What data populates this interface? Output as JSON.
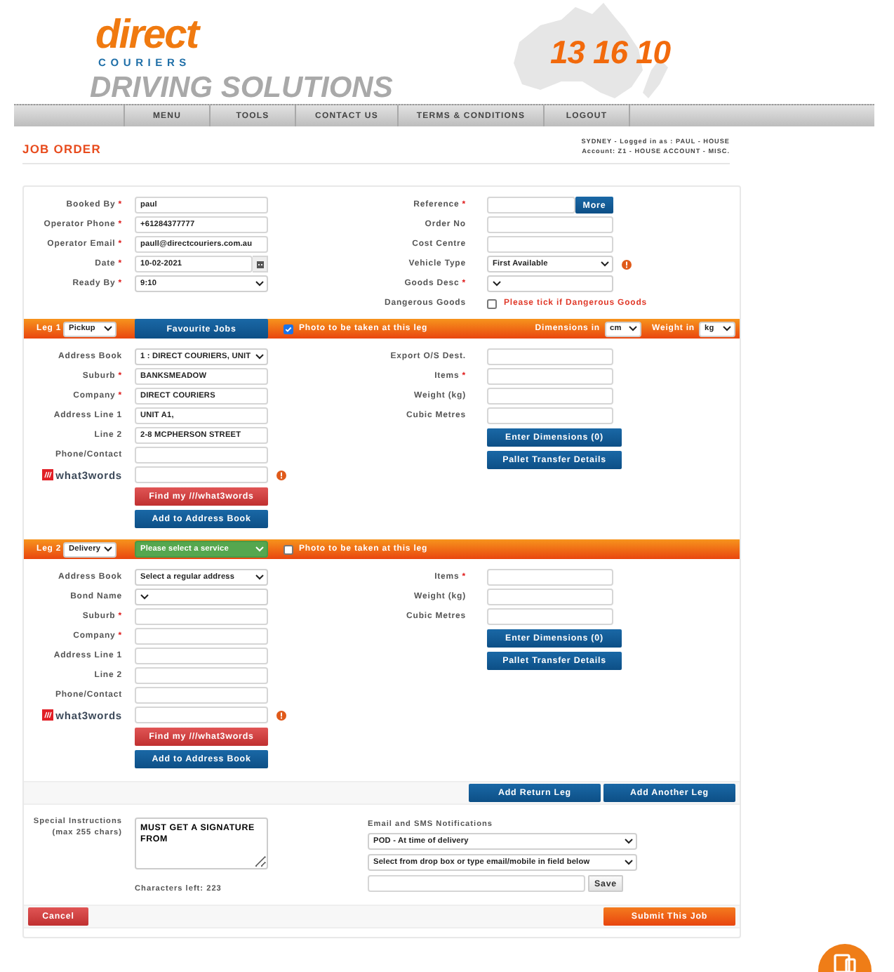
{
  "header": {
    "logo_top": "direct",
    "logo_bottom": "COURIERS",
    "tagline": "DRIVING SOLUTIONS",
    "phone": "13 16 10"
  },
  "nav": [
    "MENU",
    "TOOLS",
    "CONTACT US",
    "TERMS & CONDITIONS",
    "LOGOUT"
  ],
  "page_title": "JOB ORDER",
  "session": [
    "SYDNEY - Logged in as : PAUL - HOUSE",
    "Account: Z1 - HOUSE ACCOUNT - MISC."
  ],
  "booking": {
    "left": [
      {
        "kind": "text",
        "label": "Booked By",
        "required_mark": "*",
        "value": "paul"
      },
      {
        "kind": "text",
        "label": "Operator Phone",
        "required_mark": "*",
        "value": "+61284377777"
      },
      {
        "kind": "text",
        "label": "Operator Email",
        "required_mark": "*",
        "value": "paull@directcouriers.com.au"
      },
      {
        "kind": "date",
        "label": "Date",
        "required_mark": "*",
        "value": "10-02-2021"
      },
      {
        "kind": "select",
        "label": "Ready By",
        "required_mark": "*",
        "value": "9:10"
      }
    ],
    "right": [
      {
        "kind": "text",
        "label": "Reference",
        "required_mark": "*",
        "button": "More"
      },
      {
        "kind": "text",
        "label": "Order No"
      },
      {
        "kind": "text",
        "label": "Cost Centre"
      },
      {
        "kind": "select",
        "label": "Vehicle Type",
        "value": "First Available",
        "info": true
      },
      {
        "kind": "select",
        "label": "Goods Desc",
        "required_mark": "*"
      },
      {
        "kind": "check",
        "label": "Dangerous Goods",
        "checked": false,
        "note": "Please tick if Dangerous Goods"
      }
    ]
  },
  "legs": [
    {
      "label": "Leg 1",
      "type": "Pickup",
      "service": {
        "kind": "button",
        "text": "Favourite Jobs"
      },
      "photo": {
        "checked": true,
        "label": "Photo to be taken at this leg"
      },
      "units": [
        {
          "label": "Dimensions in",
          "value": "cm"
        },
        {
          "label": "Weight in",
          "value": "kg"
        }
      ],
      "left": [
        {
          "kind": "select",
          "label": "Address Book",
          "value": "1 : DIRECT COURIERS, UNIT"
        },
        {
          "kind": "text",
          "label": "Suburb",
          "required_mark": "*",
          "value": "BANKSMEADOW"
        },
        {
          "kind": "text",
          "label": "Company",
          "required_mark": "*",
          "value": "DIRECT COURIERS"
        },
        {
          "kind": "text",
          "label": "Address Line 1",
          "value": "UNIT A1,"
        },
        {
          "kind": "text",
          "label": "Line 2",
          "value": "2-8 MCPHERSON STREET"
        },
        {
          "kind": "text",
          "label": "Phone/Contact"
        },
        {
          "kind": "w3w",
          "label": "what3words",
          "info": true
        },
        {
          "kind": "redbutton",
          "label": "Find my ///what3words"
        },
        {
          "kind": "button",
          "label": "Add to Address Book"
        }
      ],
      "right": [
        {
          "kind": "text",
          "label": "Export O/S Dest."
        },
        {
          "kind": "text",
          "label": "Items",
          "required_mark": "*"
        },
        {
          "kind": "text",
          "label": "Weight (kg)"
        },
        {
          "kind": "text",
          "label": "Cubic Metres"
        },
        {
          "kind": "button",
          "label": "Enter Dimensions (0)"
        },
        {
          "kind": "button",
          "label": "Pallet Transfer Details"
        }
      ]
    },
    {
      "label": "Leg 2",
      "type": "Delivery",
      "service": {
        "kind": "select",
        "text": "Please select a service"
      },
      "photo": {
        "checked": false,
        "label": "Photo to be taken at this leg"
      },
      "left": [
        {
          "kind": "select",
          "label": "Address Book",
          "value": "Select a regular address"
        },
        {
          "kind": "select",
          "label": "Bond Name"
        },
        {
          "kind": "text",
          "label": "Suburb",
          "required_mark": "*"
        },
        {
          "kind": "text",
          "label": "Company",
          "required_mark": "*"
        },
        {
          "kind": "text",
          "label": "Address Line 1"
        },
        {
          "kind": "text",
          "label": "Line 2"
        },
        {
          "kind": "text",
          "label": "Phone/Contact"
        },
        {
          "kind": "w3w",
          "label": "what3words",
          "info": true
        },
        {
          "kind": "redbutton",
          "label": "Find my ///what3words"
        },
        {
          "kind": "button",
          "label": "Add to Address Book"
        }
      ],
      "right": [
        {
          "kind": "text",
          "label": "Items",
          "required_mark": "*"
        },
        {
          "kind": "text",
          "label": "Weight (kg)"
        },
        {
          "kind": "text",
          "label": "Cubic Metres"
        },
        {
          "kind": "button",
          "label": "Enter Dimensions (0)"
        },
        {
          "kind": "button",
          "label": "Pallet Transfer Details"
        }
      ]
    }
  ],
  "leg_buttons": [
    "Add Return Leg",
    "Add Another Leg"
  ],
  "instructions": {
    "label": "Special Instructions",
    "sublabel": "(max 255 chars)",
    "value": "MUST GET A SIGNATURE FROM",
    "chars_left": "Characters left: 223"
  },
  "notifications": {
    "label": "Email and SMS Notifications",
    "selects": [
      "POD - At time of delivery",
      "Select from drop box or type email/mobile in field below"
    ],
    "save": "Save"
  },
  "cancel": "Cancel",
  "submit": "Submit This Job"
}
